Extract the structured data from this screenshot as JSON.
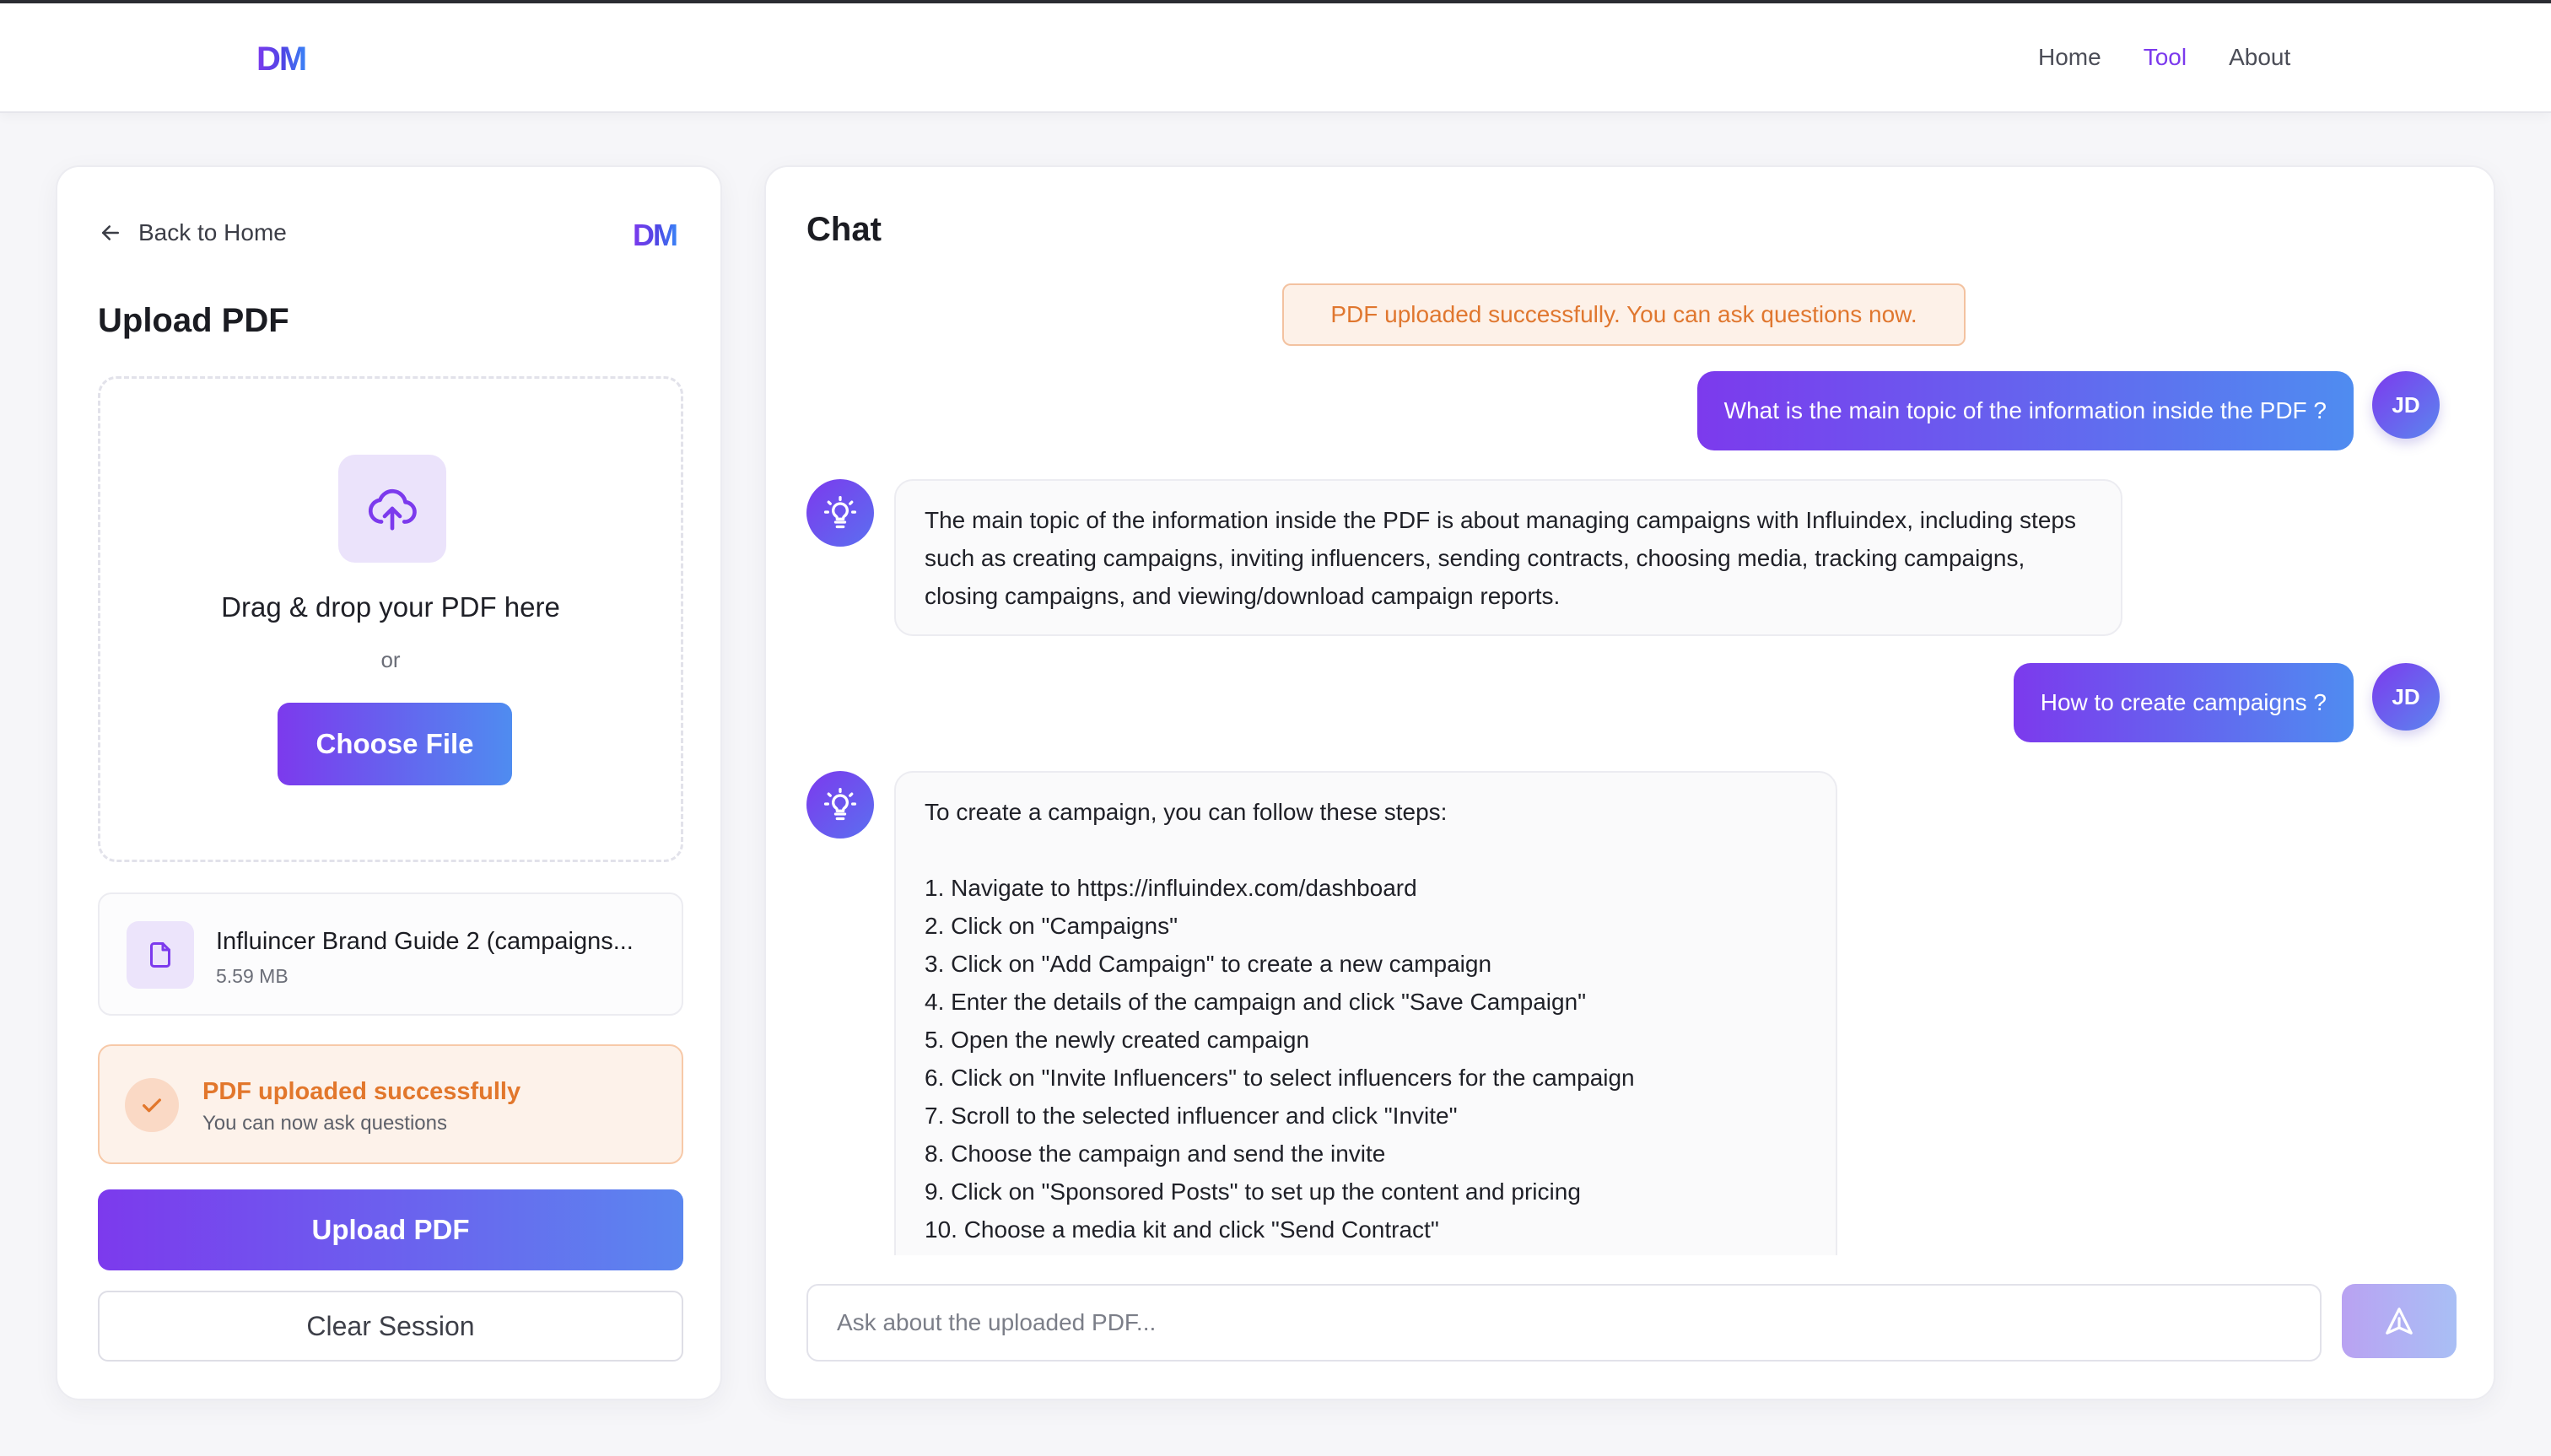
{
  "nav": {
    "logo": "DM",
    "links": [
      {
        "label": "Home",
        "active": false
      },
      {
        "label": "Tool",
        "active": true
      },
      {
        "label": "About",
        "active": false
      }
    ]
  },
  "upload_panel": {
    "back_label": "Back to Home",
    "logo": "DM",
    "title": "Upload PDF",
    "dropzone": {
      "title": "Drag & drop your PDF here",
      "or": "or",
      "choose_label": "Choose File"
    },
    "file": {
      "name": "Influincer Brand Guide 2 (campaigns...",
      "size": "5.59 MB"
    },
    "status": {
      "title": "PDF uploaded successfully",
      "subtitle": "You can now ask questions"
    },
    "upload_label": "Upload PDF",
    "clear_label": "Clear Session"
  },
  "chat": {
    "title": "Chat",
    "notice": "PDF uploaded successfully. You can ask questions now.",
    "user_initials": "JD",
    "messages": {
      "user1": "What is the main topic of the information inside the PDF ?",
      "bot1": "The main topic of the information inside the PDF is about managing campaigns with Influindex, including steps such as creating campaigns, inviting influencers, sending contracts, choosing media, tracking campaigns, closing campaigns, and viewing/download campaign reports.",
      "user2": "How to create campaigns ?",
      "bot2_intro": "To create a campaign, you can follow these steps:",
      "bot2_steps": [
        "1. Navigate to https://influindex.com/dashboard",
        "2. Click on \"Campaigns\"",
        "3. Click on \"Add Campaign\" to create a new campaign",
        "4. Enter the details of the campaign and click \"Save Campaign\"",
        "5. Open the newly created campaign",
        "6. Click on \"Invite Influencers\" to select influencers for the campaign",
        "7. Scroll to the selected influencer and click \"Invite\"",
        "8. Choose the campaign and send the invite",
        "9. Click on \"Sponsored Posts\" to set up the content and pricing",
        "10. Choose a media kit and click \"Send Contract\""
      ]
    },
    "input_placeholder": "Ask about the uploaded PDF...",
    "send_icon": "send-arrow-icon"
  },
  "colors": {
    "accent": "#7c3aed",
    "accent_end": "#4f8cf0",
    "success": "#e2772c"
  }
}
